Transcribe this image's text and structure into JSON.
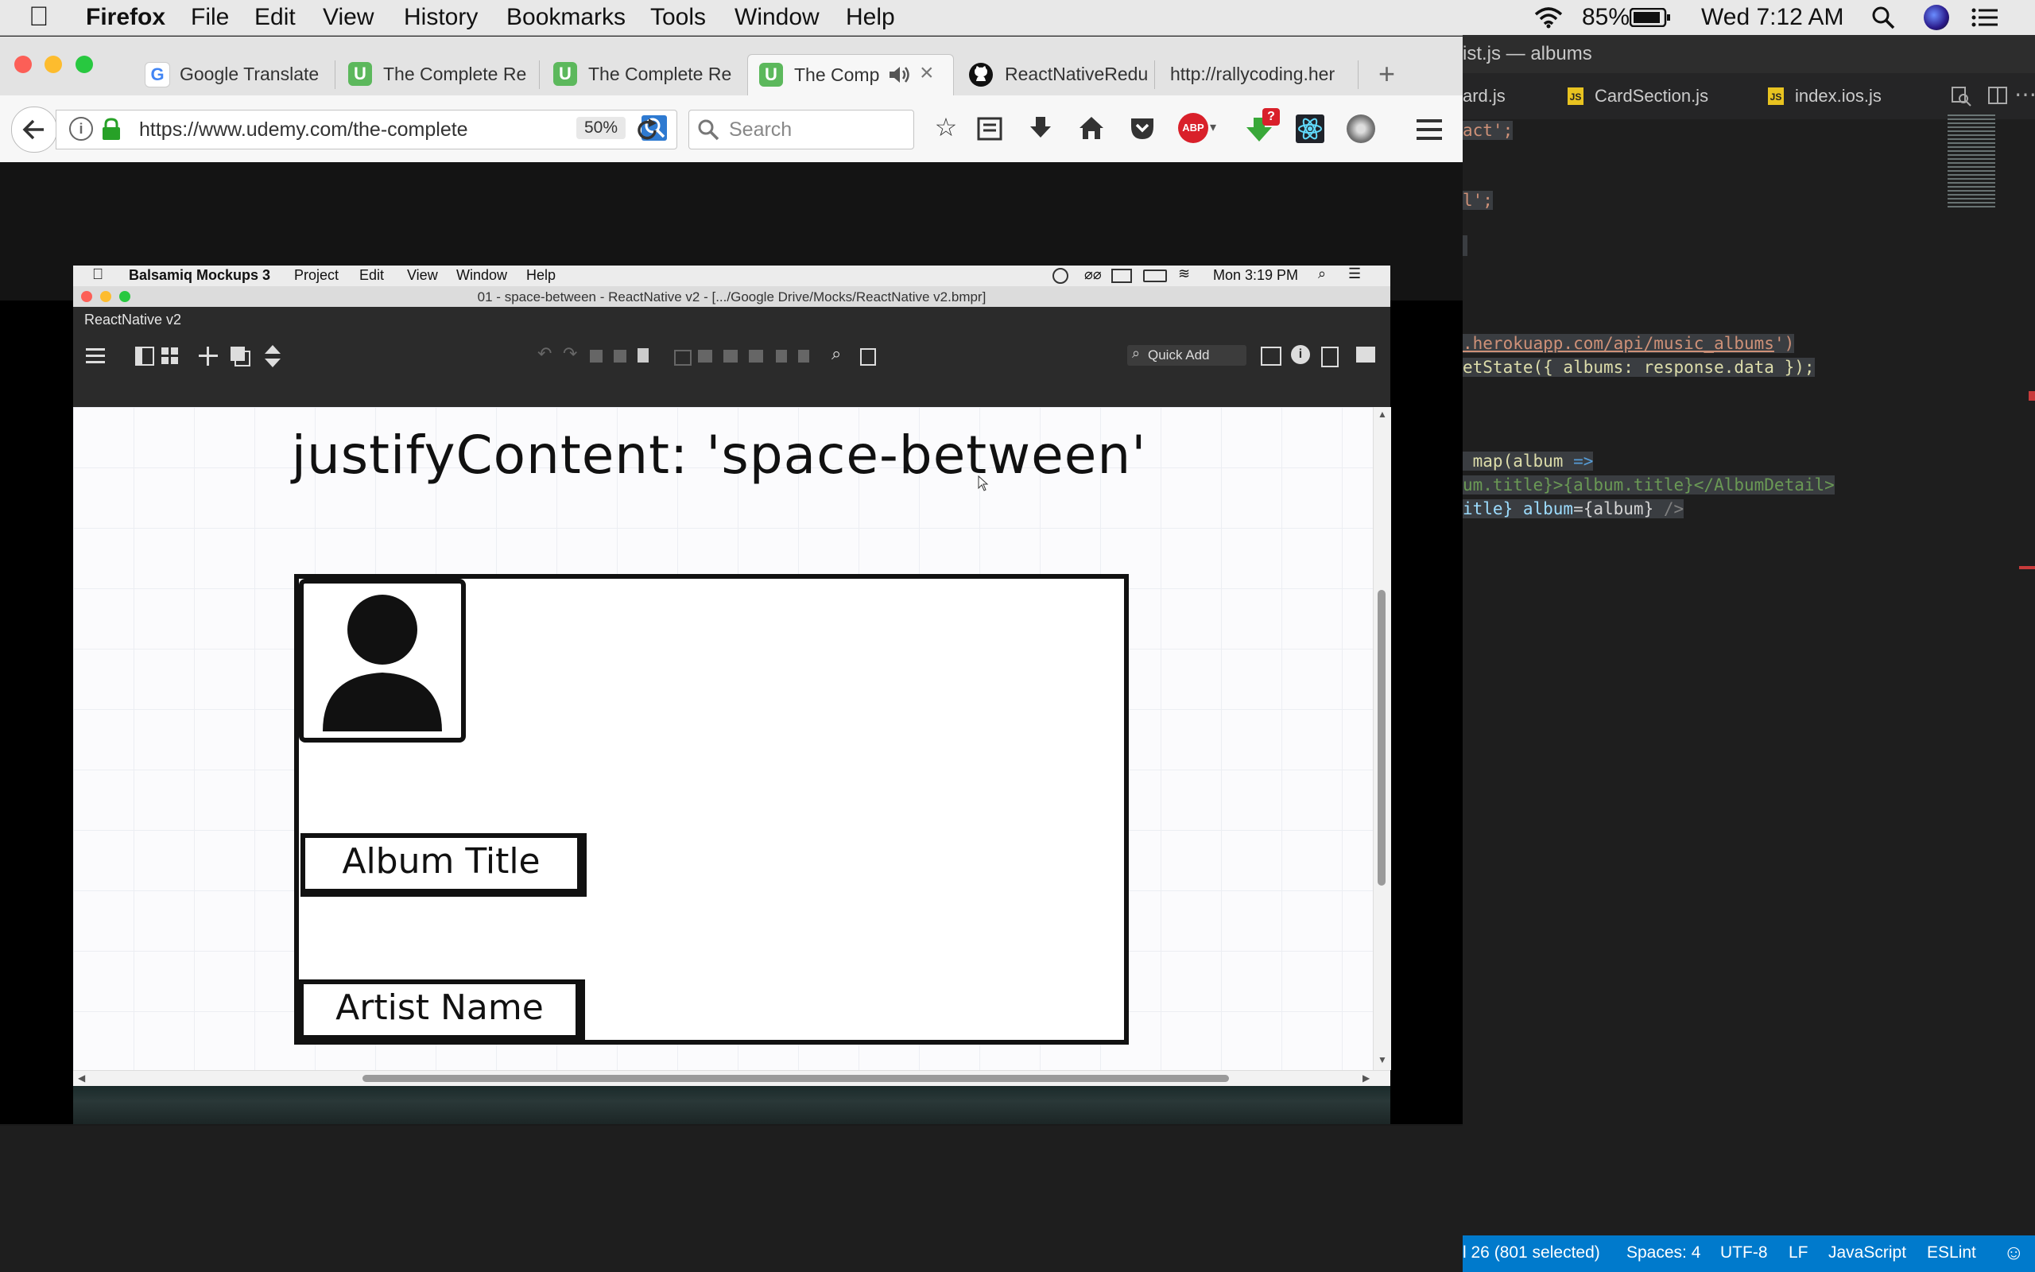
{
  "mac_menubar": {
    "app_name": "Firefox",
    "menus": [
      "File",
      "Edit",
      "View",
      "History",
      "Bookmarks",
      "Tools",
      "Window",
      "Help"
    ],
    "battery": "85%",
    "clock": "Wed 7:12 AM"
  },
  "vscode": {
    "title": "ist.js — albums",
    "tabs": [
      "ard.js",
      "CardSection.js",
      "index.ios.js"
    ],
    "code": {
      "l1": "act';",
      "l2": "l';",
      "l3_url": ".herokuapp.com/api/music_albums",
      "l3_end": "')",
      "l4": "etState({ albums: response.data });",
      "l5_a": " map(album",
      "l5_b": " =>",
      "l6": "um.title}>{album.title}</AlbumDetail>",
      "l7_a": "itle}",
      "l7_b": " album",
      "l7_c": "={album}",
      "l7_d": " />"
    },
    "status": {
      "position": "l 26 (801 selected)",
      "spaces": "Spaces: 4",
      "encoding": "UTF-8",
      "eol": "LF",
      "language": "JavaScript",
      "linter": "ESLint"
    }
  },
  "firefox": {
    "tabs": [
      {
        "label": "Google Translate",
        "icon": "google-translate-icon"
      },
      {
        "label": "The Complete Re",
        "icon": "udemy-icon"
      },
      {
        "label": "The Complete Re",
        "icon": "udemy-icon"
      },
      {
        "label": "The Comp",
        "icon": "udemy-icon"
      },
      {
        "label": "ReactNativeRedu",
        "icon": "github-icon"
      },
      {
        "label": "http://rallycoding.her",
        "icon": ""
      }
    ],
    "url": "https://www.udemy.com/the-complete",
    "zoom": "50%",
    "search_placeholder": "Search",
    "abp_badge": "ABP",
    "download_badge": "?"
  },
  "balsamiq": {
    "app_name": "Balsamiq Mockups 3",
    "menus": [
      "Project",
      "Edit",
      "View",
      "Window",
      "Help"
    ],
    "clock": "Mon 3:19 PM",
    "window_title": "01 - space-between - ReactNative v2 - [.../Google Drive/Mocks/ReactNative v2.bmpr]",
    "project_name": "ReactNative v2",
    "quick_add": "Quick Add",
    "heading": "justifyContent: 'space-between'",
    "album_title": "Album Title",
    "artist_name": "Artist Name"
  }
}
